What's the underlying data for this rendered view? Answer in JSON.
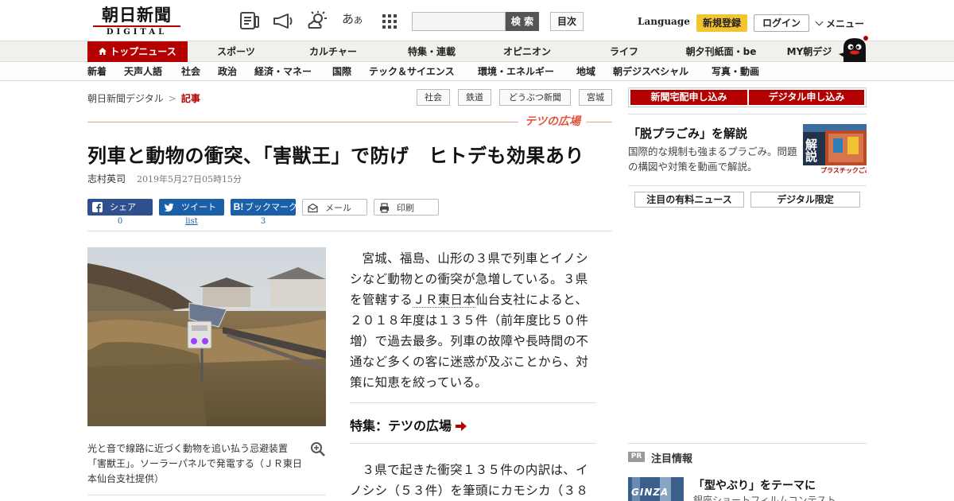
{
  "header": {
    "logo_main": "朝日新聞",
    "logo_sub": "DIGITAL",
    "search_button": "検 索",
    "toc_button": "目次",
    "language": "Language",
    "register": "新規登録",
    "login": "ログイン",
    "menu": "メニュー",
    "icons": [
      "newspaper-icon",
      "megaphone-icon",
      "weather-icon",
      "font-size-icon",
      "grid-icon"
    ],
    "font_size_glyph_1": "あ",
    "font_size_glyph_2": "あ"
  },
  "nav_main": [
    {
      "label": "トップニュース",
      "active": true
    },
    {
      "label": "スポーツ"
    },
    {
      "label": "カルチャー"
    },
    {
      "label": "特集・連載"
    },
    {
      "label": "オピニオン"
    },
    {
      "label": "ライフ"
    },
    {
      "label": "朝夕刊紙面・be"
    },
    {
      "label": "MY朝デジ"
    }
  ],
  "nav_sub": [
    "新着",
    "天声人語",
    "社会",
    "政治",
    "経済・マネー",
    "国際",
    "テック＆サイエンス",
    "環境・エネルギー",
    "地域",
    "朝デジスペシャル",
    "写真・動画"
  ],
  "breadcrumb": {
    "home": "朝日新聞デジタル",
    "sep": ">",
    "current": "記事"
  },
  "tags": [
    "社会",
    "鉄道",
    "どうぶつ新聞",
    "宮城"
  ],
  "series_label": "テツの広場",
  "article": {
    "headline": "列車と動物の衝突、「害獣王」で防げ　ヒトデも効果あり",
    "author": "志村英司",
    "date": "2019年5月27日05時15分",
    "para1_a": "宮城、福島、山形の３県で列車とイノシシなど動物との衝突が急増している。３県を管轄する",
    "para1_link": "ＪＲ東日本",
    "para1_b": "仙台支社によると、２０１８年度は１３５件（前年度比５０件増）で過去最多。列車の故障や長時間の不通など多くの客に迷惑が及ぶことから、対策に知恵を絞っている。",
    "feature_link": "特集：テツの広場",
    "para2": "３県で起きた衝突１３５件の内訳は、イノシシ（５３件）を筆頭にカモシカ（３８",
    "caption": "光と音で線路に近づく動物を追い払う忌避装置「害獣王」。ソーラーパネルで発電する（ＪＲ東日本仙台支社提供）"
  },
  "share": [
    {
      "label": "シェア",
      "count": "0",
      "icon": "facebook-icon"
    },
    {
      "label": "ツイート",
      "count": "list",
      "icon": "twitter-icon"
    },
    {
      "label": "ブックマーク",
      "count": "3",
      "icon": "hatena-bookmark-icon",
      "icon_text": "B!"
    },
    {
      "label": "メール",
      "icon": "mail-icon"
    },
    {
      "label": "印刷",
      "icon": "print-icon"
    }
  ],
  "sidebar": {
    "subscribe_home": "新聞宅配申し込み",
    "subscribe_digital": "デジタル申し込み",
    "promo_title": "「脱プラごみ」を解説",
    "promo_desc": "国際的な規制も強まるプラごみ。問題の構図や対策を動画で解説。",
    "promo_img_text": "解説",
    "promo_img_sub": "プラスチックごみ",
    "tab_paid": "注目の有料ニュース",
    "tab_digital": "デジタル限定",
    "pr_badge": "PR",
    "pr_heading": "注目情報",
    "pr_title": "「型やぶり」をテーマに",
    "pr_sub": "銀座ショートフィルムコンテスト",
    "pr_img_text": "GINZA"
  },
  "colors": {
    "brand_red": "#b40000",
    "accent_orange": "#e0553a",
    "register_yellow": "#f4c430",
    "share_blue": "#1a5fa8"
  }
}
